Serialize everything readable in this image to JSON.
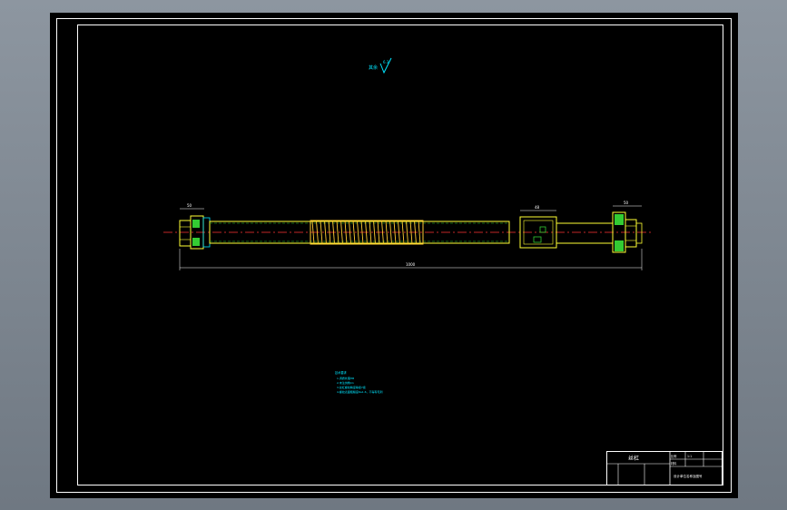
{
  "drawing": {
    "roughness_note": "其余",
    "roughness_value": "6.3",
    "dim_left_width": "50",
    "dim_nut_width": "48",
    "dim_right_width": "50",
    "dim_overall_length": "1000",
    "notes": {
      "title": "技术要求",
      "line1": "1.调质处理HB",
      "line2": "2.未注倒角C1",
      "line3": "3.丝杠螺纹精度等级7级",
      "line4": "4.螺纹表面粗糙度Ra1.6，不得有毛刺"
    },
    "title_block": {
      "part_name": "丝杠",
      "scale_label": "比例",
      "scale_value": "1:1",
      "material_label": "材料",
      "company": "设计单位名称及图号"
    }
  },
  "colors": {
    "background": "#000000",
    "frame": "#ffffff",
    "part_outline": "#ffff33",
    "centerline": "#ff3333",
    "thread": "#ffcc33",
    "hatch": "#33cc33",
    "annotation": "#00e5ff"
  }
}
